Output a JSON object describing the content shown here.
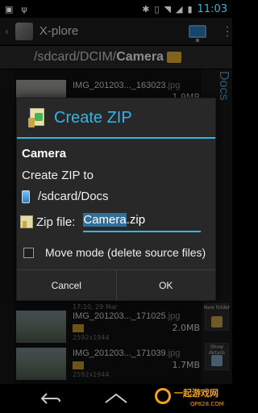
{
  "status_bar": {
    "time": "11:03",
    "left_icons": [
      "photo-icon",
      "usb-icon"
    ],
    "right_icons": [
      "bluetooth-icon",
      "vibrate-icon",
      "wifi-icon",
      "signal-icon",
      "battery-icon"
    ]
  },
  "action_bar": {
    "title": "X-plore"
  },
  "path_bar": {
    "parent_path": "/sdcard/DCIM/",
    "current_folder": "Camera"
  },
  "background_list": {
    "rows": [
      {
        "name": "IMG_201203..._163023",
        "ext": ".jpg",
        "size": "1.9MB",
        "res": "",
        "date": ""
      },
      {
        "name": "IMG_201203..._171025",
        "ext": ".jpg",
        "size": "2.0MB",
        "res": "2592x1944",
        "date": "17:10, 29 Mar"
      },
      {
        "name": "IMG_201203..._171039",
        "ext": ".jpg",
        "size": "1.7MB",
        "res": "2592x1944",
        "date": ""
      }
    ],
    "side_panel_label": "Docs",
    "side_buttons": [
      {
        "label": "New folder"
      },
      {
        "label": "Show details"
      }
    ]
  },
  "dialog": {
    "title": "Create ZIP",
    "source_folder": "Camera",
    "to_label": "Create ZIP to",
    "destination": "/sdcard/Docs",
    "zip_file_label": "Zip file:",
    "zip_name_selected": "Camera",
    "zip_name_ext": ".zip",
    "move_mode_label": "Move mode (delete source files)",
    "move_mode_checked": false,
    "cancel_label": "Cancel",
    "ok_label": "OK"
  },
  "nav_bar": {
    "icons": [
      "back-icon",
      "home-icon"
    ]
  },
  "watermark": {
    "text": "一起游戏网",
    "sub": "QP828.COM"
  },
  "colors": {
    "accent": "#33b5e5",
    "dialog_bg": "#282828",
    "selection": "#2f6f99"
  }
}
